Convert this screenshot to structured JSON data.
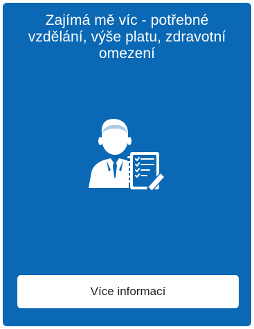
{
  "card": {
    "title": "Zajímá mě víc - potřebné vzdělání, výše platu, zdravotní omezení",
    "background_color": "#0b68b4",
    "icon": "businessman-with-checklist-icon",
    "button_label": "Více informací"
  }
}
